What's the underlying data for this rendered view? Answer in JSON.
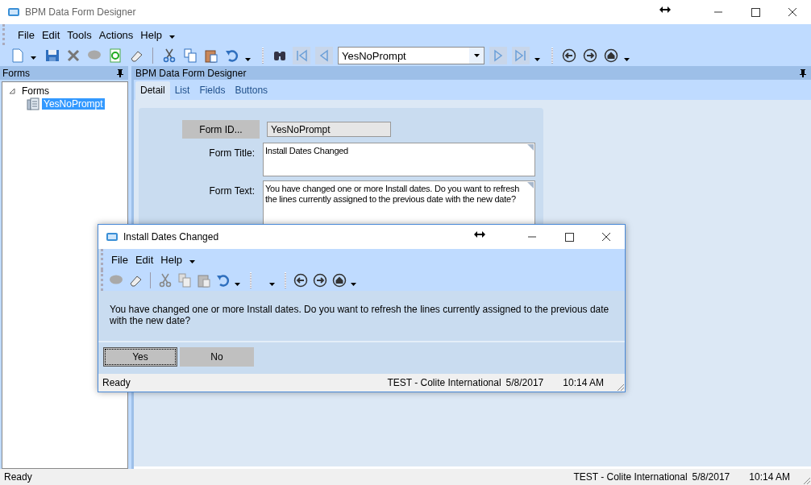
{
  "window": {
    "title": "BPM Data Form Designer"
  },
  "menu": [
    "File",
    "Edit",
    "Tools",
    "Actions",
    "Help"
  ],
  "toolbar": {
    "record_selector": {
      "value": "YesNoPrompt"
    }
  },
  "forms_panel": {
    "title": "Forms",
    "tree": [
      {
        "label": "Forms",
        "expanded": true,
        "selected": false,
        "children": [
          {
            "label": "YesNoPrompt",
            "selected": true
          }
        ]
      }
    ]
  },
  "designer": {
    "title": "BPM Data Form Designer",
    "tabs": [
      {
        "label": "Detail",
        "selected": true
      },
      {
        "label": "List",
        "selected": false
      },
      {
        "label": "Fields",
        "selected": false
      },
      {
        "label": "Buttons",
        "selected": false
      }
    ],
    "form_id_button": "Form ID...",
    "form_id": "YesNoPrompt",
    "title_label": "Form Title:",
    "title_value": "Install Dates Changed",
    "text_label": "Form Text:",
    "text_value": "You have changed one or more Install dates. Do you want to refresh the lines currently assigned to the previous date with the new date?"
  },
  "dialog": {
    "title": "Install Dates Changed",
    "menu": [
      "File",
      "Edit",
      "Help"
    ],
    "message": "You have changed one or more Install dates. Do you want to refresh the lines currently assigned to the previous date with the new date?",
    "buttons": [
      {
        "label": "Yes",
        "focused": true
      },
      {
        "label": "No",
        "focused": false
      }
    ],
    "status_bar": {
      "status": "Ready",
      "company": "TEST - Colite International",
      "date": "5/8/2017",
      "time": "10:14 AM"
    }
  },
  "status_bar": {
    "status": "Ready",
    "company": "TEST - Colite International",
    "date": "5/8/2017",
    "time": "10:14 AM"
  }
}
